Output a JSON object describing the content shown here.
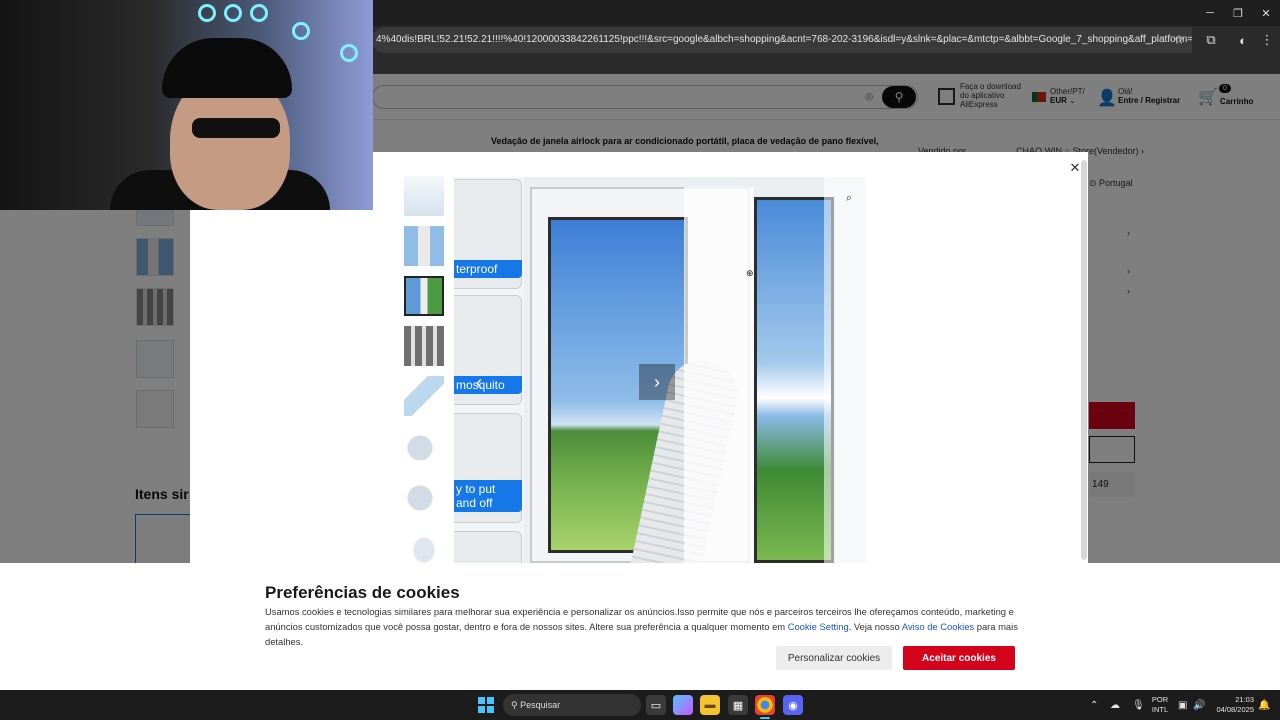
{
  "browser": {
    "url": "4%40dis!BRL!52.21!52.21!!!!%40!12000033842261125!ppc!!!&src=google&albch=shopping&acnt=768-202-3196&isdl=y&slnk=&plac=&mtctp=&albbt=Google_7_shopping&aff_platform=google&aff_s...",
    "controls": {
      "minimize": "─",
      "restore": "❐",
      "close": "✕"
    }
  },
  "header": {
    "app_download": [
      "Faça o download",
      "do aplicativo",
      "AliExpress"
    ],
    "region_line1": "Other/PT/",
    "region_line2": "EUR",
    "account_line1": "Olá!",
    "account_line2": "Entre / Registrar",
    "cart_count": "0",
    "cart_label": "Carrinho"
  },
  "product": {
    "title": "Vedação de janela airlock para ar condicionado portátil, placa de vedação de pano flexível,",
    "seller_label": "Vendido por",
    "seller_name": "CHAO WIN ○ Store(Vendedor)",
    "ship_to": "Portugal",
    "quantity_hint": "149"
  },
  "similar": {
    "title": "Itens sir"
  },
  "image_strip": {
    "labels": [
      "terproof",
      "mosquito",
      "y to put\nand off"
    ]
  },
  "cookie": {
    "title": "Preferências de cookies",
    "text_before": "Usamos cookies e tecnologias similares para melhorar sua experiência e personalizar os anúncios.Isso permite que nós e parceiros terceiros lhe ofereçamos conteúdo, marketing e anúncios customizados que você possa gostar, dentro e fora de nossos sites. Altere sua preferência a qualquer momento em ",
    "link1": "Cookie Setting",
    "text_middle": ". Veja nosso ",
    "link2": "Aviso de Cookies",
    "text_after": " para mais detalhes.",
    "btn_customize": "Personalizar cookies",
    "btn_accept": "Aceitar cookies"
  },
  "taskbar": {
    "search_placeholder": "Pesquisar",
    "lang_line1": "POR",
    "lang_line2": "INTL",
    "time": "21:03",
    "date": "04/08/2025"
  },
  "colors": {
    "accent_red": "#d3031c",
    "link_blue": "#1a56c8",
    "strip_blue": "#1677e8"
  }
}
